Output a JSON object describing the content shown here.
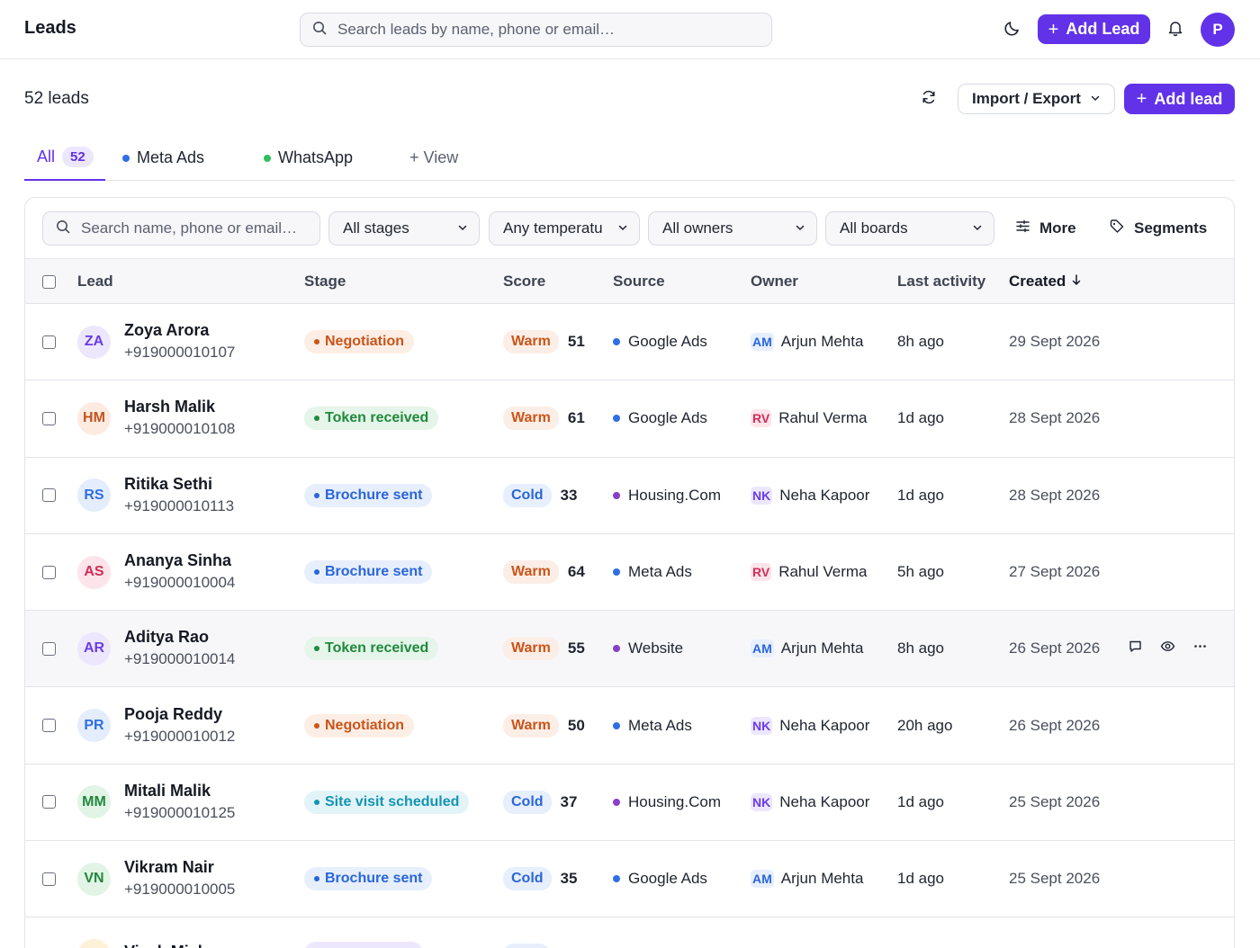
{
  "topbar": {
    "title": "Leads",
    "search_placeholder": "Search leads by name, phone or email…",
    "add_lead_label": "Add Lead",
    "user_initial": "P"
  },
  "subheader": {
    "lead_count": "52 leads",
    "import_export_label": "Import / Export",
    "add_lead_label": "Add lead"
  },
  "tabs": [
    {
      "label": "All",
      "count": "52",
      "active": true
    },
    {
      "label": "Meta Ads",
      "dot_color": "#2f6fe4"
    },
    {
      "label": "WhatsApp",
      "dot_color": "#2fbf5b"
    }
  ],
  "add_view_label": "+ View",
  "filters": {
    "search_placeholder": "Search name, phone or email…",
    "stage": "All stages",
    "temperature": "Any temperatu",
    "owner": "All owners",
    "board": "All boards",
    "more_label": "More",
    "segments_label": "Segments"
  },
  "columns": {
    "lead": "Lead",
    "stage": "Stage",
    "score": "Score",
    "source": "Source",
    "owner": "Owner",
    "last_activity": "Last activity",
    "created": "Created"
  },
  "rows": [
    {
      "initials": "ZA",
      "name": "Zoya Arora",
      "phone": "+919000010107",
      "stage": "Negotiation",
      "stage_kind": "negotiation",
      "temp": "Warm",
      "score": "51",
      "source": "Google Ads",
      "source_color": "#2f6fe4",
      "owner_initials": "AM",
      "owner": "Arjun Mehta",
      "activity": "8h ago",
      "created": "29 Sept 2026",
      "avatar_bg": "#ede7fd",
      "avatar_fg": "#6a3de6"
    },
    {
      "initials": "HM",
      "name": "Harsh Malik",
      "phone": "+919000010108",
      "stage": "Token received",
      "stage_kind": "token",
      "temp": "Warm",
      "score": "61",
      "source": "Google Ads",
      "source_color": "#2f6fe4",
      "owner_initials": "RV",
      "owner": "Rahul Verma",
      "activity": "1d ago",
      "created": "28 Sept 2026",
      "avatar_bg": "#fdebe1",
      "avatar_fg": "#c4541f"
    },
    {
      "initials": "RS",
      "name": "Ritika Sethi",
      "phone": "+919000010113",
      "stage": "Brochure sent",
      "stage_kind": "brochure",
      "temp": "Cold",
      "score": "33",
      "source": "Housing.Com",
      "source_color": "#8a3fc7",
      "owner_initials": "NK",
      "owner": "Neha Kapoor",
      "activity": "1d ago",
      "created": "28 Sept 2026",
      "avatar_bg": "#e4edfc",
      "avatar_fg": "#2f6fe4"
    },
    {
      "initials": "AS",
      "name": "Ananya Sinha",
      "phone": "+919000010004",
      "stage": "Brochure sent",
      "stage_kind": "brochure",
      "temp": "Warm",
      "score": "64",
      "source": "Meta Ads",
      "source_color": "#2f6fe4",
      "owner_initials": "RV",
      "owner": "Rahul Verma",
      "activity": "5h ago",
      "created": "27 Sept 2026",
      "avatar_bg": "#fce4ea",
      "avatar_fg": "#d12e57"
    },
    {
      "initials": "AR",
      "name": "Aditya Rao",
      "phone": "+919000010014",
      "stage": "Token received",
      "stage_kind": "token",
      "temp": "Warm",
      "score": "55",
      "source": "Website",
      "source_color": "#8a3fc7",
      "owner_initials": "AM",
      "owner": "Arjun Mehta",
      "activity": "8h ago",
      "created": "26 Sept 2026",
      "avatar_bg": "#ede7fd",
      "avatar_fg": "#6a3de6",
      "hovered": true
    },
    {
      "initials": "PR",
      "name": "Pooja Reddy",
      "phone": "+919000010012",
      "stage": "Negotiation",
      "stage_kind": "negotiation",
      "temp": "Warm",
      "score": "50",
      "source": "Meta Ads",
      "source_color": "#2f6fe4",
      "owner_initials": "NK",
      "owner": "Neha Kapoor",
      "activity": "20h ago",
      "created": "26 Sept 2026",
      "avatar_bg": "#e4edfc",
      "avatar_fg": "#2f6fe4"
    },
    {
      "initials": "MM",
      "name": "Mitali Malik",
      "phone": "+919000010125",
      "stage": "Site visit scheduled",
      "stage_kind": "site",
      "temp": "Cold",
      "score": "37",
      "source": "Housing.Com",
      "source_color": "#8a3fc7",
      "owner_initials": "NK",
      "owner": "Neha Kapoor",
      "activity": "1d ago",
      "created": "25 Sept 2026",
      "avatar_bg": "#e2f4e6",
      "avatar_fg": "#22873e"
    },
    {
      "initials": "VN",
      "name": "Vikram Nair",
      "phone": "+919000010005",
      "stage": "Brochure sent",
      "stage_kind": "brochure",
      "temp": "Cold",
      "score": "35",
      "source": "Google Ads",
      "source_color": "#2f6fe4",
      "owner_initials": "AM",
      "owner": "Arjun Mehta",
      "activity": "1d ago",
      "created": "25 Sept 2026",
      "avatar_bg": "#e2f4e6",
      "avatar_fg": "#22873e"
    },
    {
      "initials": "VM",
      "name": "Vivek Mishra",
      "phone": "",
      "stage": "",
      "stage_kind": "new",
      "temp": "",
      "score": "",
      "source": "",
      "source_color": "#2f6fe4",
      "owner_initials": "",
      "owner": "",
      "activity": "",
      "created": "",
      "avatar_bg": "#fdf1d8",
      "avatar_fg": "#b07c12",
      "partial": true
    }
  ],
  "colors": {
    "accent": "#6132e8",
    "negotiation_fg": "#c9551a",
    "negotiation_bg": "#fdeee5",
    "token_fg": "#1f8a3d",
    "token_bg": "#e6f5e9",
    "brochure_fg": "#2a66d9",
    "brochure_bg": "#e7effd",
    "site_fg": "#1494b3",
    "site_bg": "#e3f4f8",
    "new_fg": "#6a3de6",
    "new_bg": "#ede7fd",
    "warm_fg": "#c9551a",
    "warm_bg": "#fbeee7",
    "cold_fg": "#2a66d9",
    "cold_bg": "#e7effd"
  },
  "icons": [
    "search-icon",
    "moon-icon",
    "bell-icon",
    "refresh-icon",
    "chevron-down-icon",
    "sliders-icon",
    "tag-icon",
    "arrow-down-icon",
    "comment-icon",
    "eye-icon",
    "more-icon"
  ]
}
